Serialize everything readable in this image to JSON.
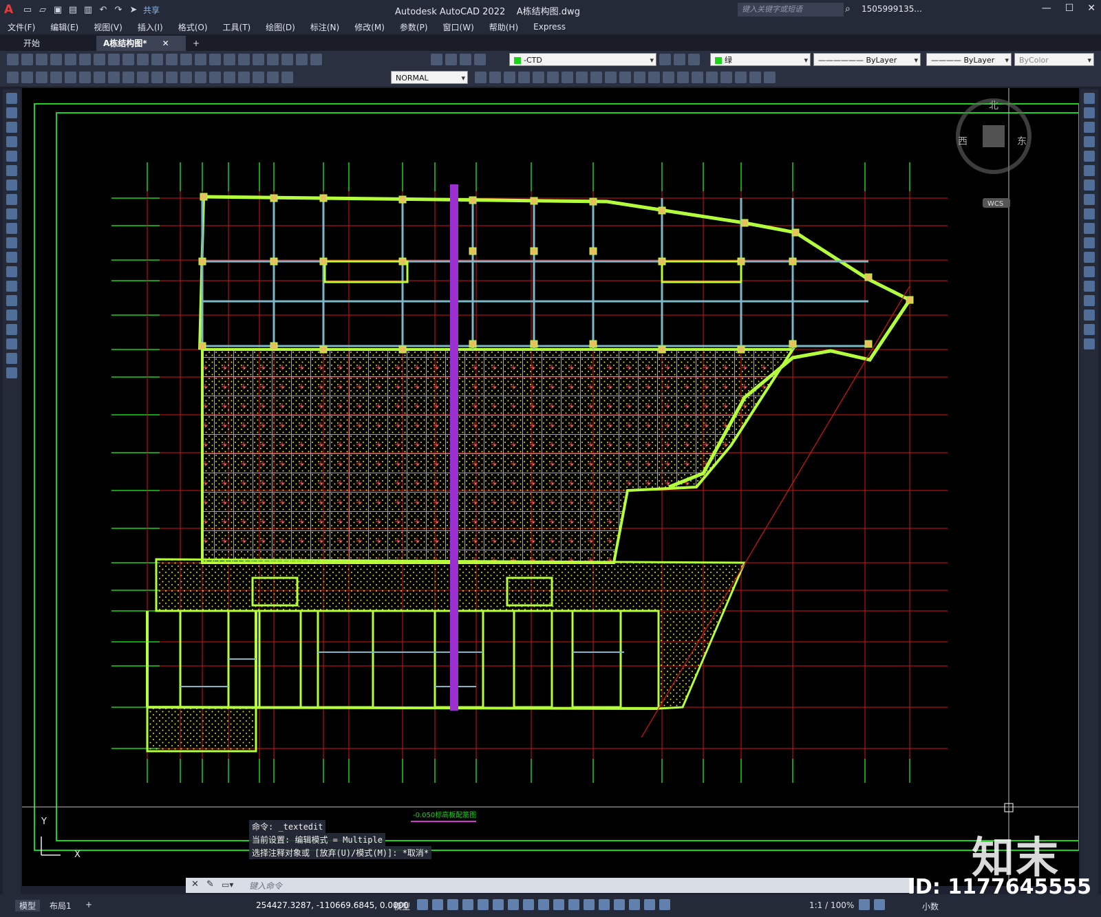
{
  "app": {
    "title": "Autodesk AutoCAD 2022",
    "document": "A栋结构图.dwg",
    "share": "共享",
    "search_placeholder": "键入关键字或短语",
    "user": "1505999135..."
  },
  "menu": [
    "文件(F)",
    "编辑(E)",
    "视图(V)",
    "插入(I)",
    "格式(O)",
    "工具(T)",
    "绘图(D)",
    "标注(N)",
    "修改(M)",
    "参数(P)",
    "窗口(W)",
    "帮助(H)",
    "Express"
  ],
  "tabs": {
    "start": "开始",
    "active": "A栋结构图*",
    "add": "+"
  },
  "layer": {
    "name": "-CTD",
    "color_name": "绿",
    "linetype": "ByLayer",
    "lineweight": "ByLayer",
    "plotstyle": "ByColor",
    "dimstyle": "NORMAL"
  },
  "viewcube": {
    "north": "北",
    "west": "西",
    "east": "东",
    "coord_system": "WCS"
  },
  "drawing": {
    "caption": "-0.050标高板配筋图"
  },
  "command": {
    "history": [
      "命令: _textedit",
      "当前设置: 编辑模式 = Multiple",
      "选择注释对象或 [放弃(U)/模式(M)]: *取消*"
    ],
    "placeholder": "键入命令"
  },
  "status": {
    "model_tab": "模型",
    "layout_tab": "布局1",
    "coordinates": "254427.3287, -110669.6845, 0.0000",
    "space": "模型",
    "scale": "1:1 / 100%",
    "units": "小数"
  },
  "watermark": {
    "brand": "知末",
    "id": "ID: 1177645555"
  },
  "colors": {
    "background": "#000000",
    "grid_red": "#d81414",
    "axis_green": "#18d418",
    "wall_yellowgreen": "#b4ff3c",
    "beam_cyan": "#7ab8c8",
    "slab_hatch": "#e8e800",
    "highlight_purple": "#9b2fd0"
  }
}
